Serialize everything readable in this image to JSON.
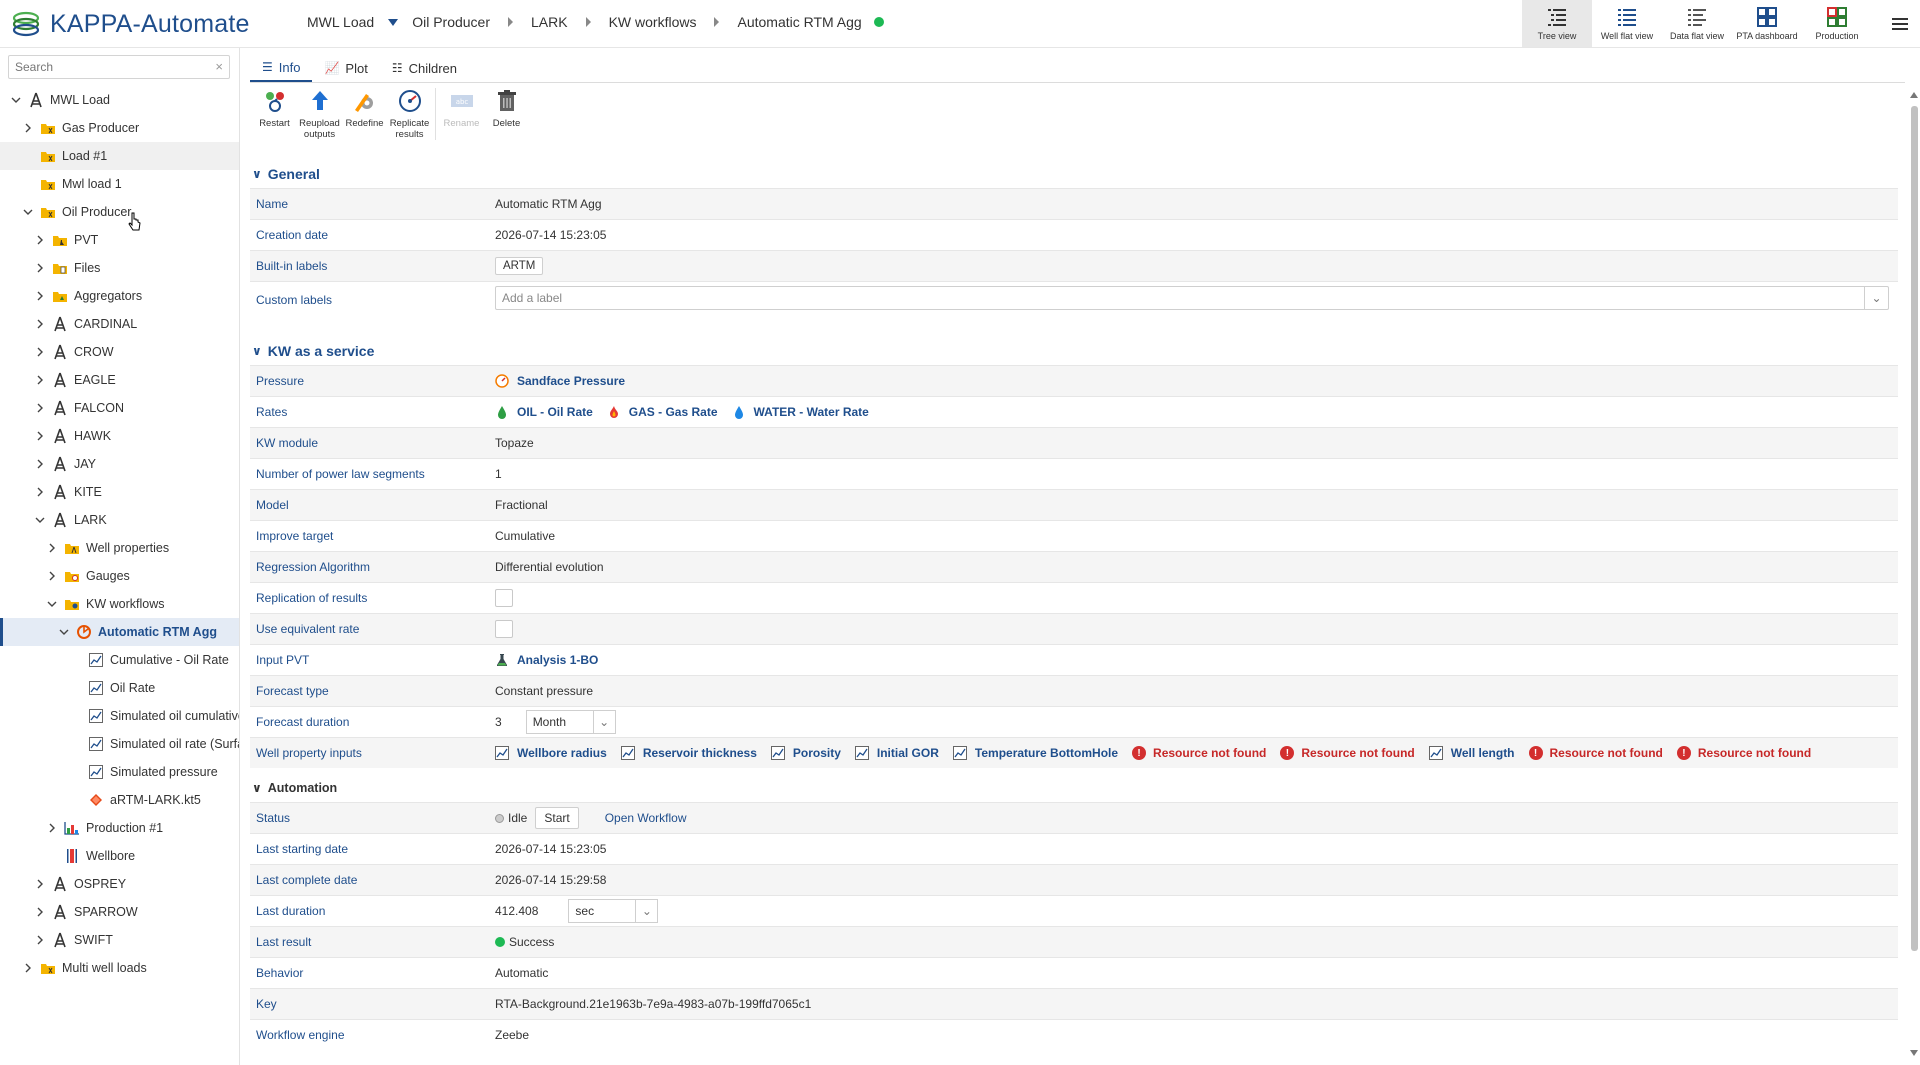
{
  "app": {
    "title": "KAPPA-Automate"
  },
  "breadcrumb": {
    "items": [
      "MWL Load",
      "Oil Producer",
      "LARK",
      "KW workflows",
      "Automatic RTM Agg"
    ],
    "status_color": "#1db954"
  },
  "views": [
    {
      "label": "Tree view",
      "icon": "tree-view-icon",
      "active": true
    },
    {
      "label": "Well flat view",
      "icon": "well-flat-view-icon"
    },
    {
      "label": "Data flat view",
      "icon": "data-flat-view-icon"
    },
    {
      "label": "PTA dashboard",
      "icon": "pta-dashboard-icon"
    },
    {
      "label": "Production",
      "icon": "production-icon"
    }
  ],
  "sidebar": {
    "search_placeholder": "Search",
    "tree": [
      {
        "label": "MWL Load",
        "level": 0,
        "expanded": true,
        "icon": "well-icon"
      },
      {
        "label": "Gas Producer",
        "level": 1,
        "expanded": false,
        "icon": "folder-icon"
      },
      {
        "label": "Load #1",
        "level": 1,
        "icon": "folder-icon",
        "hover": true
      },
      {
        "label": "Mwl load 1",
        "level": 1,
        "icon": "folder-icon"
      },
      {
        "label": "Oil Producer",
        "level": 1,
        "expanded": true,
        "icon": "folder-icon"
      },
      {
        "label": "PVT",
        "level": 2,
        "expanded": false,
        "icon": "pvt-folder-icon"
      },
      {
        "label": "Files",
        "level": 2,
        "expanded": false,
        "icon": "files-folder-icon"
      },
      {
        "label": "Aggregators",
        "level": 2,
        "expanded": false,
        "icon": "aggregators-folder-icon"
      },
      {
        "label": "CARDINAL",
        "level": 2,
        "expanded": false,
        "icon": "well-icon"
      },
      {
        "label": "CROW",
        "level": 2,
        "expanded": false,
        "icon": "well-icon"
      },
      {
        "label": "EAGLE",
        "level": 2,
        "expanded": false,
        "icon": "well-icon"
      },
      {
        "label": "FALCON",
        "level": 2,
        "expanded": false,
        "icon": "well-icon"
      },
      {
        "label": "HAWK",
        "level": 2,
        "expanded": false,
        "icon": "well-icon"
      },
      {
        "label": "JAY",
        "level": 2,
        "expanded": false,
        "icon": "well-icon"
      },
      {
        "label": "KITE",
        "level": 2,
        "expanded": false,
        "icon": "well-icon"
      },
      {
        "label": "LARK",
        "level": 2,
        "expanded": true,
        "icon": "well-icon"
      },
      {
        "label": "Well properties",
        "level": 3,
        "expanded": false,
        "icon": "well-properties-folder-icon"
      },
      {
        "label": "Gauges",
        "level": 3,
        "expanded": false,
        "icon": "gauges-folder-icon"
      },
      {
        "label": "KW workflows",
        "level": 3,
        "expanded": true,
        "icon": "kw-workflows-folder-icon"
      },
      {
        "label": "Automatic RTM Agg",
        "level": 4,
        "expanded": true,
        "icon": "rtm-agg-icon",
        "selected": true
      },
      {
        "label": "Cumulative - Oil Rate",
        "level": 5,
        "icon": "line-chart-icon"
      },
      {
        "label": "Oil Rate",
        "level": 5,
        "icon": "line-chart-icon"
      },
      {
        "label": "Simulated oil cumulative",
        "level": 5,
        "icon": "line-chart-icon"
      },
      {
        "label": "Simulated oil rate (Surfac",
        "level": 5,
        "icon": "line-chart-icon"
      },
      {
        "label": "Simulated pressure",
        "level": 5,
        "icon": "line-chart-icon"
      },
      {
        "label": "aRTM-LARK.kt5",
        "level": 5,
        "icon": "kt5-file-icon"
      },
      {
        "label": "Production #1",
        "level": 3,
        "expanded": false,
        "icon": "production-chart-icon"
      },
      {
        "label": "Wellbore",
        "level": 3,
        "icon": "wellbore-icon"
      },
      {
        "label": "OSPREY",
        "level": 2,
        "expanded": false,
        "icon": "well-icon"
      },
      {
        "label": "SPARROW",
        "level": 2,
        "expanded": false,
        "icon": "well-icon"
      },
      {
        "label": "SWIFT",
        "level": 2,
        "expanded": false,
        "icon": "well-icon"
      },
      {
        "label": "Multi well loads",
        "level": 1,
        "expanded": false,
        "icon": "folder-icon"
      }
    ]
  },
  "tabs": [
    {
      "label": "Info",
      "icon": "info-list-icon",
      "active": true
    },
    {
      "label": "Plot",
      "icon": "plot-icon"
    },
    {
      "label": "Children",
      "icon": "children-icon"
    }
  ],
  "actions": {
    "restart": "Restart",
    "reupload": "Reupload outputs",
    "redefine": "Redefine",
    "replicate": "Replicate results",
    "rename": "Rename",
    "delete": "Delete"
  },
  "general": {
    "title": "General",
    "name_label": "Name",
    "name": "Automatic RTM Agg",
    "creation_label": "Creation date",
    "creation": "2026-07-14 15:23:05",
    "builtin_label": "Built-in labels",
    "builtin": "ARTM",
    "custom_label": "Custom labels",
    "custom_placeholder": "Add a label"
  },
  "kw": {
    "title": "KW as a service",
    "pressure_label": "Pressure",
    "pressure": "Sandface Pressure",
    "rates_label": "Rates",
    "rates": [
      "OIL - Oil Rate",
      "GAS - Gas Rate",
      "WATER - Water Rate"
    ],
    "module_label": "KW module",
    "module": "Topaze",
    "segments_label": "Number of power law segments",
    "segments": "1",
    "model_label": "Model",
    "model": "Fractional",
    "improve_label": "Improve target",
    "improve": "Cumulative",
    "regression_label": "Regression Algorithm",
    "regression": "Differential evolution",
    "replication_label": "Replication of results",
    "equiv_label": "Use equivalent rate",
    "pvt_label": "Input PVT",
    "pvt": "Analysis 1-BO",
    "forecast_type_label": "Forecast type",
    "forecast_type": "Constant pressure",
    "forecast_dur_label": "Forecast duration",
    "forecast_dur": "3",
    "forecast_unit": "Month",
    "wp_label": "Well property inputs",
    "wp": [
      {
        "text": "Wellbore radius",
        "error": false
      },
      {
        "text": "Reservoir thickness",
        "error": false
      },
      {
        "text": "Porosity",
        "error": false
      },
      {
        "text": "Initial GOR",
        "error": false
      },
      {
        "text": "Temperature BottomHole",
        "error": false
      },
      {
        "text": "Resource not found",
        "error": true
      },
      {
        "text": "Resource not found",
        "error": true
      },
      {
        "text": "Well length",
        "error": false
      },
      {
        "text": "Resource not found",
        "error": true
      },
      {
        "text": "Resource not found",
        "error": true
      }
    ]
  },
  "automation": {
    "title": "Automation",
    "status_label": "Status",
    "status": "Idle",
    "start": "Start",
    "open_workflow": "Open Workflow",
    "last_start_label": "Last starting date",
    "last_start": "2026-07-14 15:23:05",
    "last_complete_label": "Last complete date",
    "last_complete": "2026-07-14 15:29:58",
    "last_duration_label": "Last duration",
    "last_duration": "412.408",
    "duration_unit": "sec",
    "last_result_label": "Last result",
    "last_result": "Success",
    "behavior_label": "Behavior",
    "behavior": "Automatic",
    "key_label": "Key",
    "key": "RTA-Background.21e1963b-7e9a-4983-a07b-199ffd7065c1",
    "engine_label": "Workflow engine",
    "engine": "Zeebe"
  },
  "colors": {
    "brand": "#1f4e8c",
    "success": "#1db954",
    "error": "#d32f2f"
  }
}
